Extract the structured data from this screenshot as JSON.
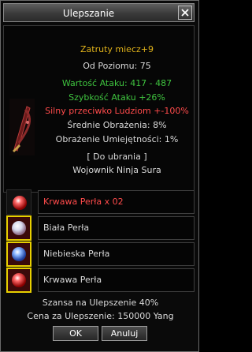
{
  "window": {
    "title": "Ulepszanie"
  },
  "item": {
    "name": "Zatruty miecz+9",
    "level_line": "Od Poziomu: 75",
    "attack_value": "Wartość Ataku: 417 - 487",
    "attack_speed": "Szybkość Ataku +26%",
    "bonus_vs": "Silny przeciwko Ludziom +-100%",
    "avg_damage": "Średnie Obrażenia: 8%",
    "skill_damage": "Obrażenie Umiejętności: 1%",
    "wear_type": "[ Do ubrania ]",
    "class_line": "Wojownik Ninja Sura"
  },
  "materials": [
    {
      "label": "Krwawa Perła x 02",
      "color": "#ff4b4b",
      "pearl": "red"
    },
    {
      "label": "Biała Perła",
      "color": "#d9d9d9",
      "pearl": "white"
    },
    {
      "label": "Niebieska Perła",
      "color": "#d9d9d9",
      "pearl": "blue"
    },
    {
      "label": "Krwawa Perła",
      "color": "#d9d9d9",
      "pearl": "red"
    }
  ],
  "upgrade": {
    "chance": "Szansa na Ulepszenie 40%",
    "cost": "Cena za Ulepszenie: 150000 Yang"
  },
  "buttons": {
    "ok": "OK",
    "cancel": "Anuluj"
  },
  "icons": {
    "close": "close-icon",
    "weapon": "sword-icon",
    "pearl_red": "red-pearl-icon",
    "pearl_white": "white-pearl-icon",
    "pearl_blue": "blue-pearl-icon"
  }
}
